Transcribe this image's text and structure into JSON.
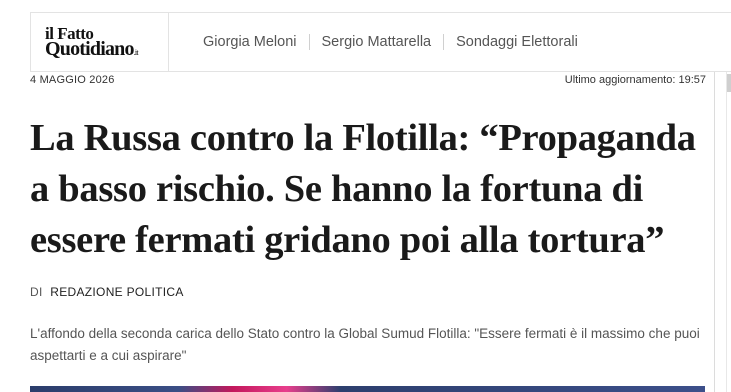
{
  "header": {
    "logo": {
      "line1": "il Fatto",
      "line2": "Quotidiano",
      "suffix": ".it"
    },
    "nav": [
      {
        "label": "Giorgia Meloni"
      },
      {
        "label": "Sergio Mattarella"
      },
      {
        "label": "Sondaggi Elettorali"
      }
    ]
  },
  "article": {
    "date": "4 MAGGIO 2026",
    "updated": "Ultimo aggiornamento: 19:57",
    "headline": "La Russa contro la Flotilla: “Propaganda a basso rischio. Se hanno la fortuna di essere fermati gridano poi alla tortura”",
    "byline_prefix": "DI",
    "byline_author": "REDAZIONE POLITICA",
    "summary": "L'affondo della seconda carica dello Stato contro la Global Sumud Flotilla: \"Essere fermati è il massimo che puoi aspettarti e a cui aspirare\""
  }
}
